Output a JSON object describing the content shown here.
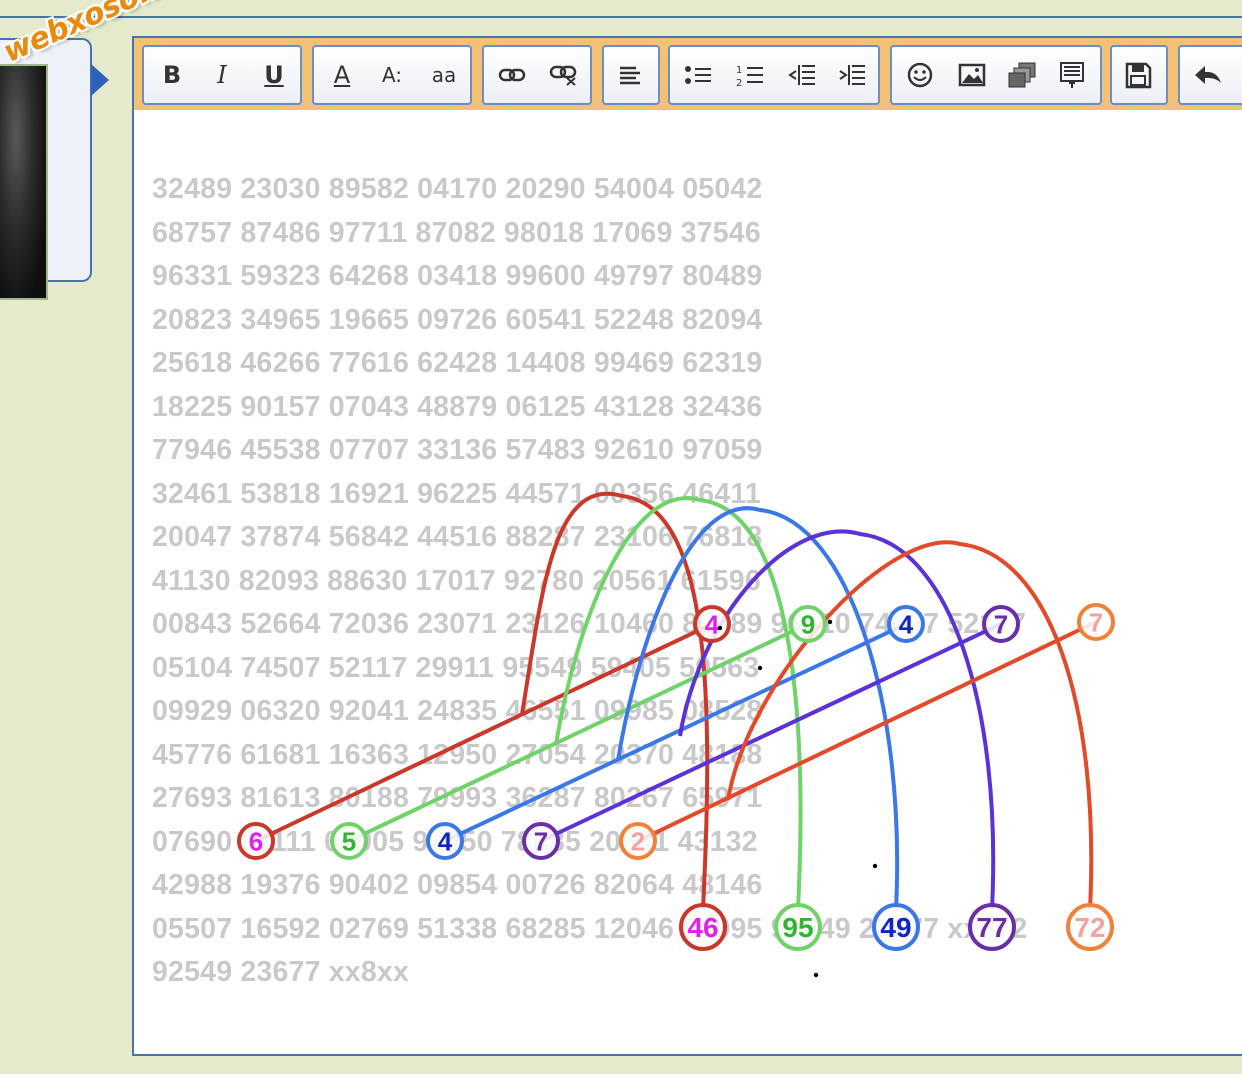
{
  "site": {
    "watermark": "webxoso.net"
  },
  "toolbar": {
    "groups": [
      [
        {
          "name": "bold",
          "label": "B"
        },
        {
          "name": "italic",
          "label": "I"
        },
        {
          "name": "underline",
          "label": "U"
        }
      ],
      [
        {
          "name": "font-color",
          "label": "A"
        },
        {
          "name": "font-size",
          "label": "A:"
        },
        {
          "name": "font-family",
          "label": "aa"
        }
      ],
      [
        {
          "name": "insert-link",
          "label": ""
        },
        {
          "name": "remove-link",
          "label": ""
        }
      ],
      [
        {
          "name": "align",
          "label": ""
        }
      ],
      [
        {
          "name": "bullet-list",
          "label": ""
        },
        {
          "name": "number-list",
          "label": ""
        },
        {
          "name": "outdent",
          "label": ""
        },
        {
          "name": "indent",
          "label": ""
        }
      ],
      [
        {
          "name": "smilie",
          "label": ""
        },
        {
          "name": "image",
          "label": ""
        },
        {
          "name": "media",
          "label": ""
        },
        {
          "name": "code",
          "label": ""
        }
      ],
      [
        {
          "name": "save",
          "label": ""
        }
      ],
      [
        {
          "name": "undo",
          "label": ""
        }
      ]
    ]
  },
  "editor": {
    "lines": [
      "32489 23030 89582 04170 20290 54004 05042",
      "68757 87486 97711 87082 98018 17069 37546",
      "96331 59323 64268 03418 99600 49797 80489",
      "20823 34965 19665 09726 60541 52248 82094",
      "25618 46266 77616 62428 14408 99469 62319",
      "18225 90157 07043 48879 06125 43128 32436",
      "77946 45538 07707 33136 57483 92610 97059",
      "32461 53818 16921 96225 44571 00356 46411",
      "20047 37874 56842 44516 88287 23106 76818",
      "41130 82093 88630 17017 92780 20561 61596",
      "00843 52664 72036 23071 23126 10460 85689 96510 74507 52117",
      "05104 74507 52117 29911 95549 59405 50563",
      "09929 06320 92041 24835 46551 09985 08528",
      "45776 61681 16363 12950 27054 20370 48188",
      "27693 81613 80188 79993 36287 80267 65971",
      "07690 81111 07905 92050 78885 20681 43132",
      "42988 19376 90402 09854 00726 82064 48146",
      "05507 16592 02769 51338 68285 12046 55095 92549 23677 xx872",
      "92549 23677 xx8xx"
    ]
  },
  "annotations": {
    "start_circles": [
      {
        "label": "6",
        "color": "#c9382a",
        "text_color": "#e020e8"
      },
      {
        "label": "5",
        "color": "#6fd36a",
        "text_color": "#32b432"
      },
      {
        "label": "4",
        "color": "#3b78e6",
        "text_color": "#1224c8"
      },
      {
        "label": "7",
        "color": "#6a2ea6",
        "text_color": "#6a2ea6"
      },
      {
        "label": "2",
        "color": "#f0813a",
        "text_color": "#f2a3a0"
      }
    ],
    "mid_circles": [
      {
        "label": "4",
        "color": "#c9382a",
        "text_color": "#e020e8"
      },
      {
        "label": "9",
        "color": "#6fd36a",
        "text_color": "#32b432"
      },
      {
        "label": "4",
        "color": "#3b78e6",
        "text_color": "#1224c8"
      },
      {
        "label": "7",
        "color": "#6a2ea6",
        "text_color": "#6a2ea6"
      },
      {
        "label": "7",
        "color": "#f0813a",
        "text_color": "#f2a3a0"
      }
    ],
    "end_circles": [
      {
        "label": "46",
        "color": "#c9382a",
        "text_color": "#e020e8"
      },
      {
        "label": "95",
        "color": "#6fd36a",
        "text_color": "#32b432"
      },
      {
        "label": "49",
        "color": "#3b78e6",
        "text_color": "#1224c8"
      },
      {
        "label": "77",
        "color": "#6a2ea6",
        "text_color": "#6a2ea6"
      },
      {
        "label": "72",
        "color": "#f0813a",
        "text_color": "#f2a3a0"
      }
    ],
    "line_colors": [
      "#c9382a",
      "#6fd36a",
      "#3b78e6",
      "#5b32d6",
      "#e24a2a"
    ]
  }
}
